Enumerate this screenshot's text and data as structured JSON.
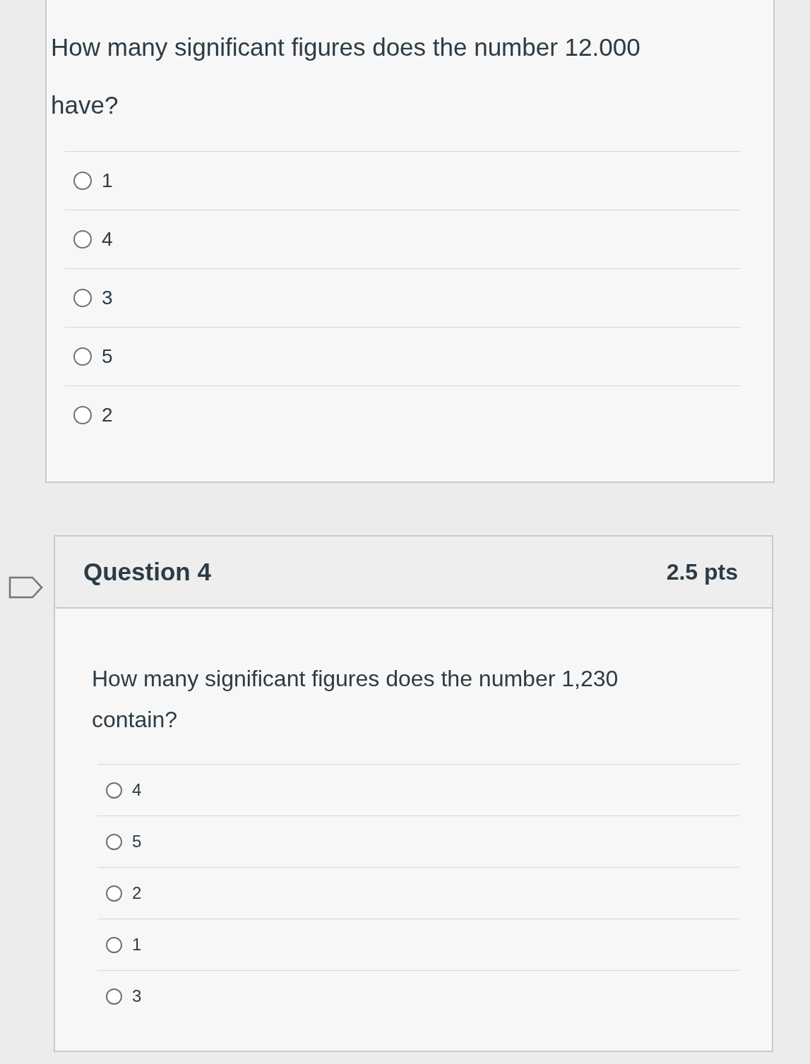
{
  "previous_question": {
    "text": "How many significant figures does the number 12.000 have?",
    "options": [
      {
        "label": "1",
        "selected": false
      },
      {
        "label": "4",
        "selected": false
      },
      {
        "label": "3",
        "selected": false
      },
      {
        "label": "5",
        "selected": false
      },
      {
        "label": "2",
        "selected": false
      }
    ]
  },
  "question": {
    "title": "Question 4",
    "points": "2.5 pts",
    "flagged": false,
    "text": "How many significant figures does the number 1,230 contain?",
    "options": [
      {
        "label": "4",
        "selected": false
      },
      {
        "label": "5",
        "selected": false
      },
      {
        "label": "2",
        "selected": false
      },
      {
        "label": "1",
        "selected": false
      },
      {
        "label": "3",
        "selected": false
      }
    ]
  }
}
